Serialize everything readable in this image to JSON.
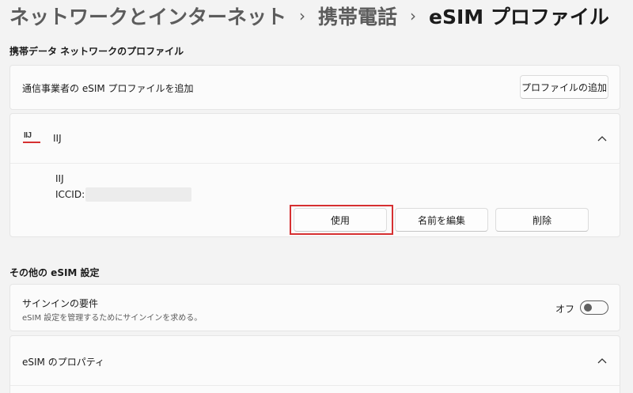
{
  "breadcrumb": {
    "level1": "ネットワークとインターネット",
    "level2": "携帯電話",
    "current": "eSIM プロファイル",
    "separator": "›"
  },
  "profiles_section": {
    "title": "携帯データ ネットワークのプロファイル",
    "add_row_label": "通信事業者の eSIM プロファイルを追加",
    "add_button": "プロファイルの追加"
  },
  "profile": {
    "logo_text": "IIJ",
    "name": "IIJ",
    "detail_name": "IIJ",
    "iccid_label": "ICCID:",
    "use_button": "使用",
    "rename_button": "名前を編集",
    "delete_button": "削除"
  },
  "other_section": {
    "title": "その他の eSIM 設定",
    "signin_title": "サインインの要件",
    "signin_desc": "eSIM 設定を管理するためにサインインを求める。",
    "toggle_state_label": "オフ",
    "properties_title": "eSIM のプロパティ"
  },
  "colors": {
    "highlight": "#d63031",
    "page_background": "#f3f3f3",
    "card_background": "#fbfbfb"
  }
}
